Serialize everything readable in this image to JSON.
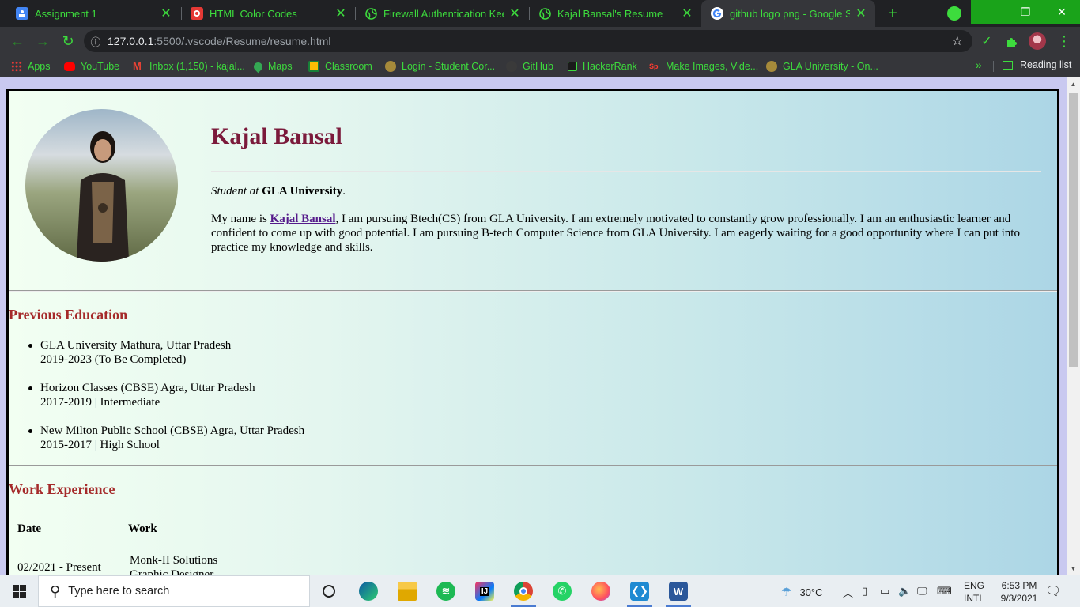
{
  "browser": {
    "tabs": [
      {
        "title": "Assignment 1",
        "favicon": "classroom-icon",
        "color": "#4285f4"
      },
      {
        "title": "HTML Color Codes",
        "favicon": "html-color-codes-icon",
        "color": "#e53935"
      },
      {
        "title": "Firewall Authentication Keepa",
        "favicon": "globe-icon",
        "color": "#3ddc3d"
      },
      {
        "title": "Kajal Bansal's Resume",
        "favicon": "globe-icon",
        "color": "#3ddc3d"
      },
      {
        "title": "github logo png - Google Se",
        "favicon": "google-icon",
        "color": "#ffffff"
      }
    ],
    "address": {
      "host": "127.0.0.1",
      "path": ":5500/.vscode/Resume/resume.html"
    },
    "bookmarks": [
      {
        "label": "Apps",
        "icon": "apps-grid-icon"
      },
      {
        "label": "YouTube",
        "icon": "youtube-icon"
      },
      {
        "label": "Inbox (1,150) - kajal...",
        "icon": "gmail-icon"
      },
      {
        "label": "Maps",
        "icon": "maps-icon"
      },
      {
        "label": "Classroom",
        "icon": "classroom-icon"
      },
      {
        "label": "Login - Student Cor...",
        "icon": "gla-icon"
      },
      {
        "label": "GitHub",
        "icon": "github-icon"
      },
      {
        "label": "HackerRank",
        "icon": "hackerrank-icon"
      },
      {
        "label": "Make Images, Vide...",
        "icon": "spark-icon"
      },
      {
        "label": "GLA University - On...",
        "icon": "gla-icon"
      }
    ],
    "reading_list": "Reading list",
    "accent_color": "#3ddc3d"
  },
  "resume": {
    "name": "Kajal Bansal",
    "role_prefix": "Student at",
    "role_org": "GLA University",
    "role_suffix": ".",
    "bio_prefix": "My name is",
    "bio_link": "Kajal Bansal",
    "bio_rest": ", I am pursuing Btech(CS) from GLA University. I am extremely motivated to constantly grow professionally. I am an enthusiastic learner and confident to come up with good potential. I am pursuing B-tech Computer Science from GLA University. I am eagerly waiting for a good opportunity where I can put into practice my knowledge and skills.",
    "education_heading": "Previous Education",
    "education": [
      {
        "school": "GLA University Mathura, Uttar Pradesh",
        "years": "2019-2023 (To Be Completed)",
        "level": ""
      },
      {
        "school": "Horizon Classes (CBSE) Agra, Uttar Pradesh",
        "years": "2017-2019",
        "level": "Intermediate"
      },
      {
        "school": "New Milton Public School (CBSE) Agra, Uttar Pradesh",
        "years": "2015-2017",
        "level": "High School"
      }
    ],
    "work_heading": "Work Experience",
    "work_table": {
      "headers": [
        "Date",
        "Work"
      ],
      "rows": [
        {
          "date": "02/2021 - Present",
          "company": "Monk-II Solutions",
          "role": "Graphic Designer"
        }
      ]
    },
    "colors": {
      "name": "#7b1a3b",
      "headings": "#a52a2a",
      "link": "#551a8b"
    }
  },
  "taskbar": {
    "search_placeholder": "Type here to search",
    "apps": [
      "task-view-icon",
      "edge-icon",
      "file-explorer-icon",
      "spotify-icon",
      "intellij-icon",
      "chrome-icon",
      "whatsapp-icon",
      "firefox-icon",
      "vscode-icon",
      "word-icon"
    ],
    "weather": "30°C",
    "lang_line1": "ENG",
    "lang_line2": "INTL",
    "time": "6:53 PM",
    "date": "9/3/2021"
  }
}
